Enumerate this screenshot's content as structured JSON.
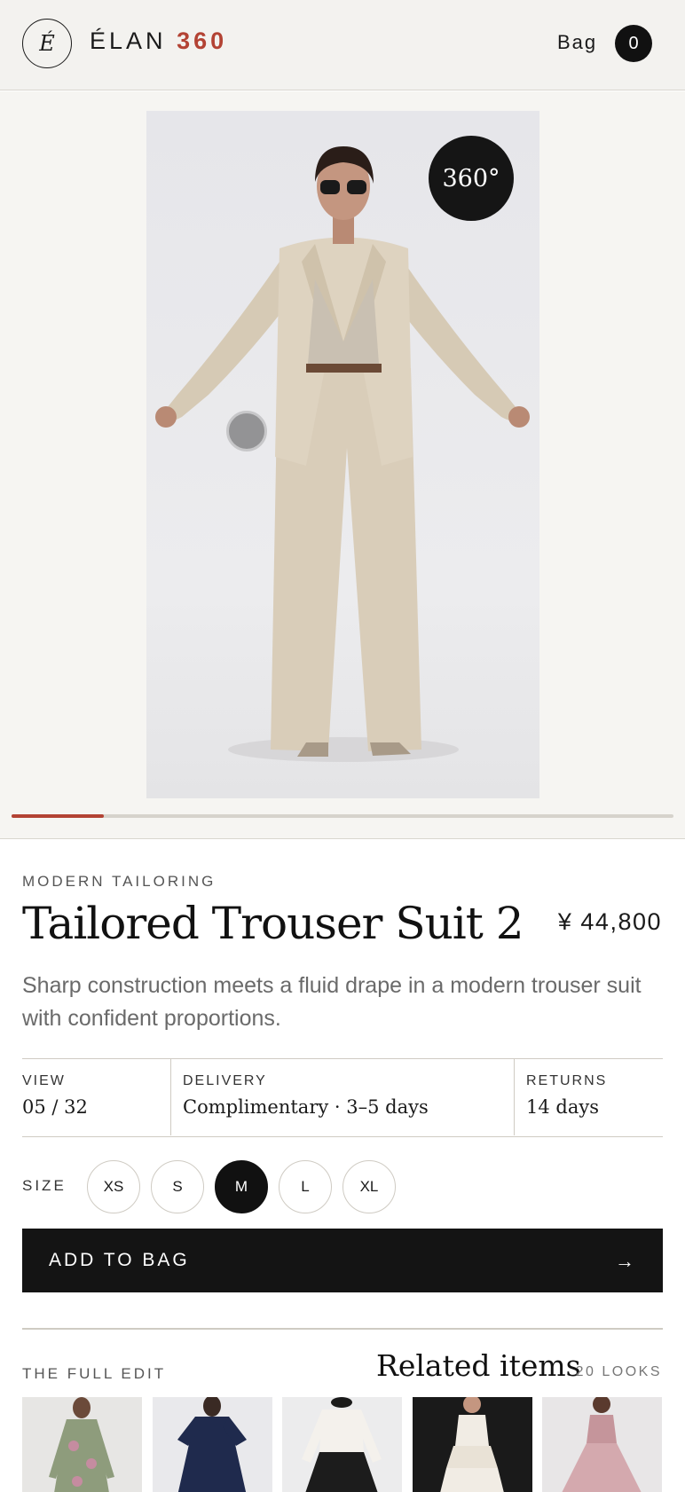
{
  "header": {
    "logo_letter": "É",
    "brand_name": "ÉLAN",
    "brand_accent": "360",
    "bag_label": "Bag",
    "bag_count": "0"
  },
  "hero": {
    "badge": "360°",
    "progress_fraction": 0.14
  },
  "product": {
    "category": "MODERN TAILORING",
    "title": "Tailored Trouser Suit 2",
    "price": "¥ 44,800",
    "description": "Sharp construction meets a fluid drape in a modern trouser suit with confident proportions."
  },
  "info": {
    "view_label": "VIEW",
    "view_value": "05 / 32",
    "delivery_label": "DELIVERY",
    "delivery_value": "Complimentary · 3–5 days",
    "returns_label": "RETURNS",
    "returns_value": "14 days"
  },
  "sizes": {
    "label": "SIZE",
    "options": [
      "XS",
      "S",
      "M",
      "L",
      "XL"
    ],
    "selected": "M"
  },
  "cta": {
    "add_to_bag": "ADD TO BAG",
    "arrow": "→"
  },
  "related": {
    "edit_label": "THE FULL EDIT",
    "title": "Related items",
    "looks": "20 LOOKS"
  },
  "colors": {
    "accent": "#b34334",
    "dark": "#141414",
    "suit": "#d9cdb9",
    "background": "#f6f5f2"
  }
}
